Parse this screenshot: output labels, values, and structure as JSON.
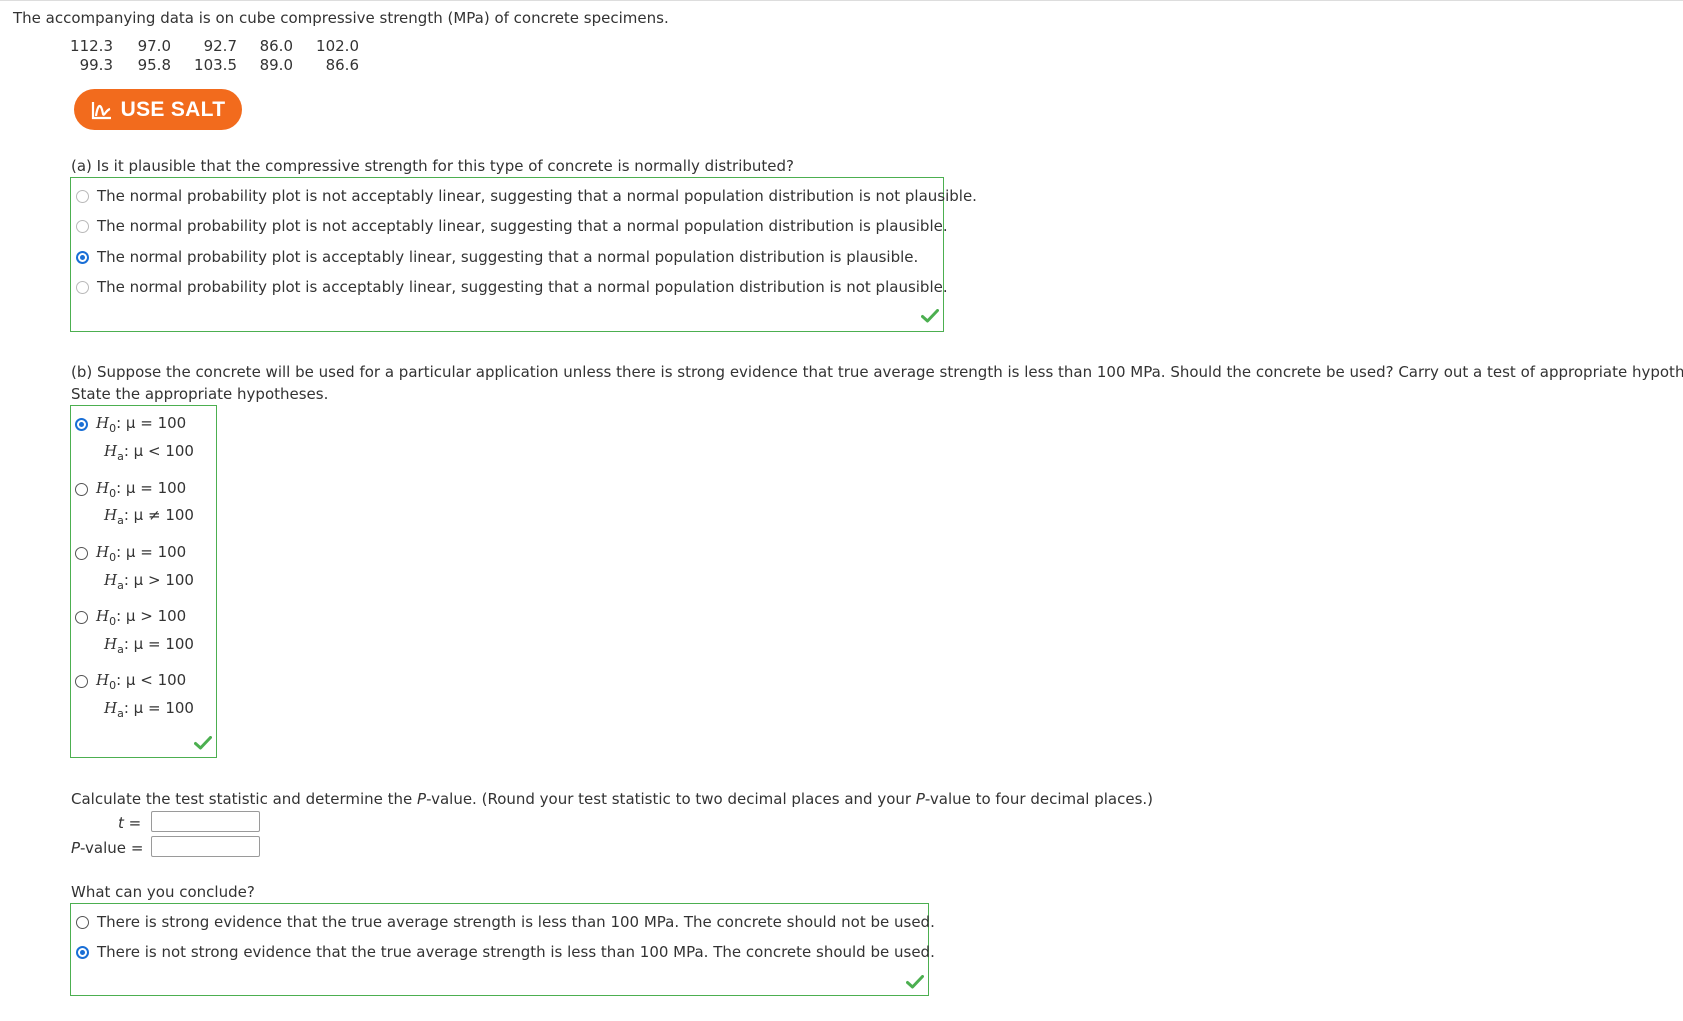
{
  "intro": "The accompanying data is on cube compressive strength (MPa) of concrete specimens.",
  "data_rows": [
    [
      "112.3",
      "97.0",
      "92.7",
      "86.0",
      "102.0"
    ],
    [
      "99.3",
      "95.8",
      "103.5",
      "89.0",
      "86.6"
    ]
  ],
  "salt_button": "USE SALT",
  "part_a": {
    "question": "(a) Is it plausible that the compressive strength for this type of concrete is normally distributed?",
    "options": [
      "The normal probability plot is not acceptably linear, suggesting that a normal population distribution is not plausible.",
      "The normal probability plot is not acceptably linear, suggesting that a normal population distribution is plausible.",
      "The normal probability plot is acceptably linear, suggesting that a normal population distribution is plausible.",
      "The normal probability plot is acceptably linear, suggesting that a normal population distribution is not plausible."
    ],
    "selected_index": 2
  },
  "part_b": {
    "question": "(b) Suppose the concrete will be used for a particular application unless there is strong evidence that true average strength is less than 100 MPa. Should the concrete be used? Carry out a test of appropriate hypotheses.",
    "instruction": "State the appropriate hypotheses.",
    "hypotheses": [
      {
        "h0": ": μ = 100",
        "ha": ": μ < 100"
      },
      {
        "h0": ": μ = 100",
        "ha": ": μ ≠ 100"
      },
      {
        "h0": ": μ = 100",
        "ha": ": μ > 100"
      },
      {
        "h0": ": μ > 100",
        "ha": ": μ = 100"
      },
      {
        "h0": ": μ < 100",
        "ha": ": μ = 100"
      }
    ],
    "h0_symbol": "H",
    "h0_sub": "0",
    "ha_symbol": "H",
    "ha_sub": "a",
    "selected_index": 0,
    "calc_instruction_pre": "Calculate the test statistic and determine the ",
    "calc_instruction_p": "P",
    "calc_instruction_mid": "-value. (Round your test statistic to two decimal places and your ",
    "calc_instruction_p2": "P",
    "calc_instruction_post": "-value to four decimal places.)",
    "t_label": "t",
    "eq": "=",
    "p_label_p": "P",
    "p_label_rest": "-value",
    "t_value": "",
    "p_value": "",
    "conclude_question": "What can you conclude?",
    "conclusions": [
      "There is strong evidence that the true average strength is less than 100 MPa. The concrete should not be used.",
      "There is not strong evidence that the true average strength is less than 100 MPa. The concrete should be used."
    ],
    "conclusion_selected_index": 1
  },
  "colors": {
    "accent": "#f26b1d",
    "correct_border": "#4caf50",
    "radio_selected": "#1a6fd6"
  }
}
